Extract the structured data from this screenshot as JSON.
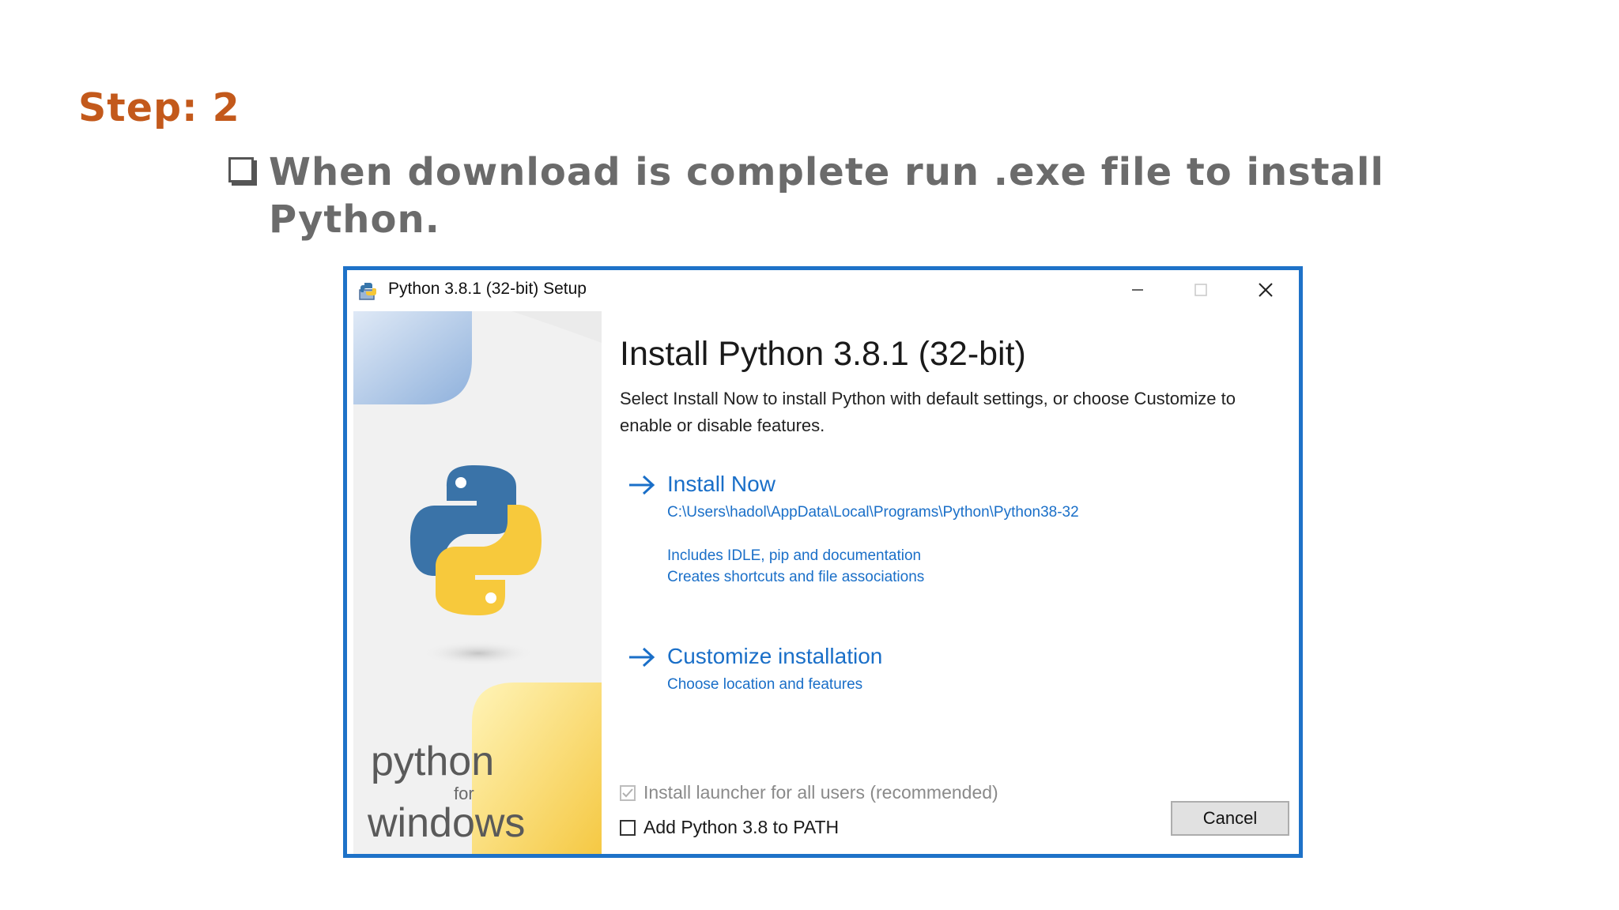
{
  "slide": {
    "step_title": "Step: 2",
    "bullet_text": "When download is complete run .exe file to install Python."
  },
  "window": {
    "title": "Python 3.8.1 (32-bit) Setup",
    "heading": "Install Python 3.8.1 (32-bit)",
    "description": "Select Install Now to install Python with default settings, or choose Customize to enable or disable features.",
    "install_now": {
      "label": "Install Now",
      "path": "C:\\Users\\hadol\\AppData\\Local\\Programs\\Python\\Python38-32",
      "detail1": "Includes IDLE, pip and documentation",
      "detail2": "Creates shortcuts and file associations"
    },
    "customize": {
      "label": "Customize installation",
      "detail": "Choose location and features"
    },
    "checkbox_launcher": {
      "label": "Install launcher for all users (recommended)",
      "checked": true,
      "disabled": true
    },
    "checkbox_path": {
      "label": "Add Python 3.8 to PATH",
      "checked": false
    },
    "cancel_label": "Cancel",
    "branding": {
      "line1": "python",
      "line2": "for",
      "line3": "windows"
    }
  },
  "colors": {
    "accent": "#1a6fc8",
    "step_orange": "#c3591b",
    "window_border": "#1e72c8"
  }
}
